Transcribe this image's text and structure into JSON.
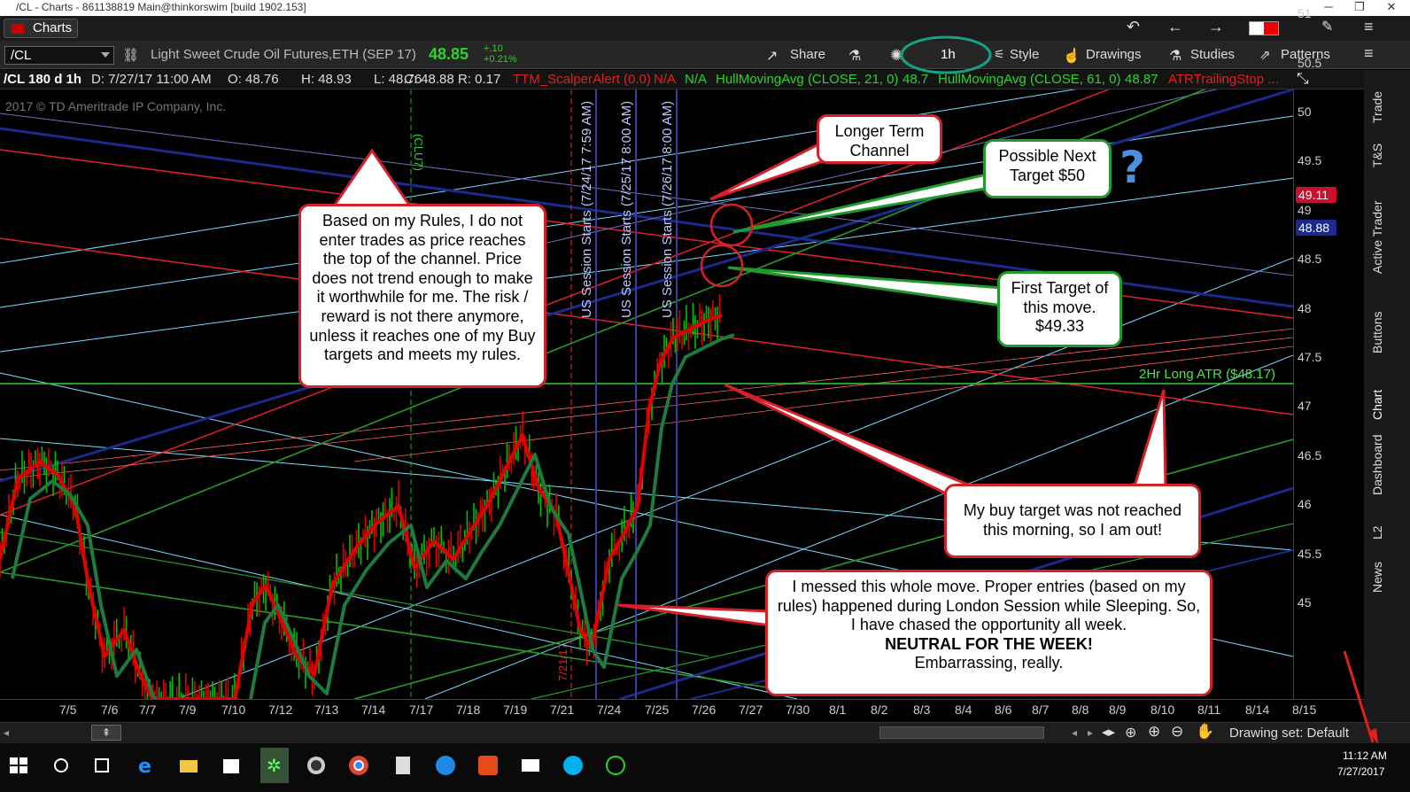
{
  "window": {
    "title": "/CL - Charts - 861138819 Main@thinkorswim [build 1902.153]",
    "controls": [
      "─",
      "❐",
      "✕"
    ]
  },
  "menu": {
    "tab_label": "Charts"
  },
  "toolbar": {
    "symbol": "/CL",
    "description": "Light Sweet Crude Oil Futures,ETH (SEP 17)",
    "last": "48.85",
    "change_abs": "+.10",
    "change_pct": "+0.21%",
    "share": "Share",
    "timeframe": "1h",
    "style": "Style",
    "drawings": "Drawings",
    "studies": "Studies",
    "patterns": "Patterns"
  },
  "infobar": {
    "title": "/CL 180 d 1h",
    "date": "D: 7/27/17 11:00 AM",
    "open": "O: 48.76",
    "high": "H: 48.93",
    "low": "L: 48.76",
    "close": "C: 48.88",
    "range": "R: 0.17",
    "study1": "TTM_ScalperAlert (0.0)",
    "na1": "N/A",
    "na2": "N/A",
    "study2": "HullMovingAvg (CLOSE, 21, 0)",
    "study2_val": "48.7",
    "study3": "HullMovingAvg (CLOSE, 61, 0)",
    "study3_val": "48.87",
    "study4": "ATRTrailingStop ..."
  },
  "copyright": "2017 © TD Ameritrade IP Company, Inc.",
  "chart_data": {
    "type": "candlestick",
    "y_ticks": [
      "51",
      "50.5",
      "50",
      "49.5",
      "49",
      "48.5",
      "48",
      "47.5",
      "47",
      "46.5",
      "46",
      "45.5",
      "45"
    ],
    "ylim": [
      45,
      51.1
    ],
    "x_ticks": [
      "7/5",
      "7/6",
      "7/7",
      "7/9",
      "7/10",
      "7/12",
      "7/13",
      "7/14",
      "7/17",
      "7/18",
      "7/19",
      "7/21",
      "7/24",
      "7/25",
      "7/26",
      "7/27",
      "7/30",
      "8/1",
      "8/2",
      "8/3",
      "8/4",
      "8/6",
      "8/7",
      "8/8",
      "8/9",
      "8/10",
      "8/11",
      "8/14",
      "8/15"
    ],
    "price_tags": [
      {
        "value": "49.11",
        "color": "#c8102e"
      },
      {
        "value": "48.88",
        "color": "#1c2a8c"
      }
    ],
    "atr_label": "2Hr Long ATR ($48.17)",
    "sessions": [
      "US Session Starts (7/24/17 7:59 AM)",
      "US Session Starts (7/25/17 8:00 AM)",
      "US Session Starts (7/26/17 8:00 AM)"
    ],
    "expiry_labels": [
      "(CLU7)",
      "7/21/17"
    ]
  },
  "callouts": {
    "rules": "Based on my Rules, I do not enter trades as price reaches the top of the channel.  Price does not trend enough to make it worthwhile for me.  The risk / reward is not there anymore, unless it reaches one of my Buy targets and meets my rules.",
    "longer_term": "Longer Term Channel",
    "next_target": "Possible Next Target $50",
    "first_target": "First Target of this move. $49.33",
    "buy_target": "My buy target was not reached this morning, so I am out!",
    "messed_1": "I messed this whole move.  Proper entries (based on my rules) happened during London Session while Sleeping. So, I have chased the opportunity all week.",
    "messed_bold": "NEUTRAL FOR THE WEEK!",
    "messed_2": "Embarrassing, really.",
    "question": "?"
  },
  "sidebar": [
    "Trade",
    "T&S",
    "Active Trader",
    "Buttons",
    "Chart",
    "Dashboard",
    "L2",
    "News"
  ],
  "bottom": {
    "drawing_set": "Drawing set: Default"
  },
  "clock": {
    "time": "11:12 AM",
    "date": "7/27/2017"
  },
  "colors": {
    "accent_green": "#2fd12f",
    "accent_red": "#d42027",
    "channel_blue": "#1c2a8c"
  }
}
